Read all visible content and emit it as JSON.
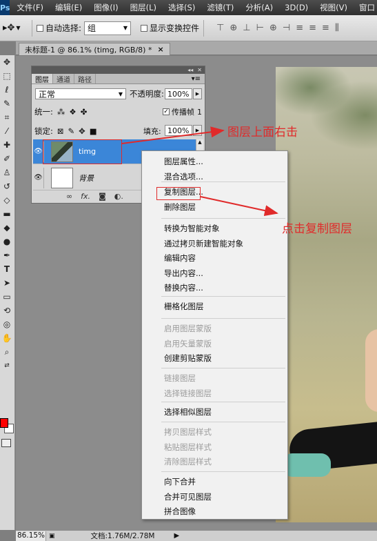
{
  "app": {
    "logo": "Ps",
    "menu": [
      "文件(F)",
      "编辑(E)",
      "图像(I)",
      "图层(L)",
      "选择(S)",
      "滤镜(T)",
      "分析(A)",
      "3D(D)",
      "视图(V)",
      "窗口"
    ]
  },
  "options_bar": {
    "auto_select_label": "自动选择:",
    "auto_select_value": "组",
    "show_transform_label": "显示变换控件"
  },
  "document_tab": {
    "title": "未标题-1 @ 86.1% (timg, RGB/8) *"
  },
  "layers_panel": {
    "tabs": [
      "图层",
      "通道",
      "路径"
    ],
    "blend_mode": "正常",
    "opacity_label": "不透明度:",
    "opacity_value": "100%",
    "unify_label": "统一:",
    "propagate_label": "传播帧",
    "propagate_value": "1",
    "lock_label": "锁定:",
    "fill_label": "填充:",
    "fill_value": "100%",
    "layers": [
      {
        "name": "timg",
        "selected": true,
        "visible": true
      },
      {
        "name": "背景",
        "selected": false,
        "visible": true
      }
    ],
    "footer_icons": [
      "link-icon",
      "fx-icon",
      "mask-icon",
      "adjustment-icon"
    ]
  },
  "context_menu": {
    "groups": [
      [
        {
          "label": "图层属性...",
          "enabled": true
        },
        {
          "label": "混合选项...",
          "enabled": true
        }
      ],
      [
        {
          "label": "复制图层...",
          "enabled": true
        },
        {
          "label": "删除图层",
          "enabled": true
        }
      ],
      [
        {
          "label": "转换为智能对象",
          "enabled": true
        },
        {
          "label": "通过拷贝新建智能对象",
          "enabled": true
        },
        {
          "label": "编辑内容",
          "enabled": true
        },
        {
          "label": "导出内容...",
          "enabled": true
        },
        {
          "label": "替换内容...",
          "enabled": true
        }
      ],
      [
        {
          "label": "栅格化图层",
          "enabled": true
        }
      ],
      [
        {
          "label": "启用图层蒙版",
          "enabled": false
        },
        {
          "label": "启用矢量蒙版",
          "enabled": false
        },
        {
          "label": "创建剪贴蒙版",
          "enabled": true
        }
      ],
      [
        {
          "label": "链接图层",
          "enabled": false
        },
        {
          "label": "选择链接图层",
          "enabled": false
        }
      ],
      [
        {
          "label": "选择相似图层",
          "enabled": true
        }
      ],
      [
        {
          "label": "拷贝图层样式",
          "enabled": false
        },
        {
          "label": "粘贴图层样式",
          "enabled": false
        },
        {
          "label": "清除图层样式",
          "enabled": false
        }
      ],
      [
        {
          "label": "向下合并",
          "enabled": true
        },
        {
          "label": "合并可见图层",
          "enabled": true
        },
        {
          "label": "拼合图像",
          "enabled": true
        }
      ]
    ]
  },
  "annotations": {
    "layer_right_click": "图层上面右击",
    "click_duplicate": "点击复制图层"
  },
  "status_bar": {
    "zoom": "86.15%",
    "doc_info": "文档:1.76M/2.78M"
  },
  "colors": {
    "foreground": "#ff0000",
    "background": "#ffffff",
    "annotation": "#e02a2a",
    "selection": "#3b86d8"
  }
}
